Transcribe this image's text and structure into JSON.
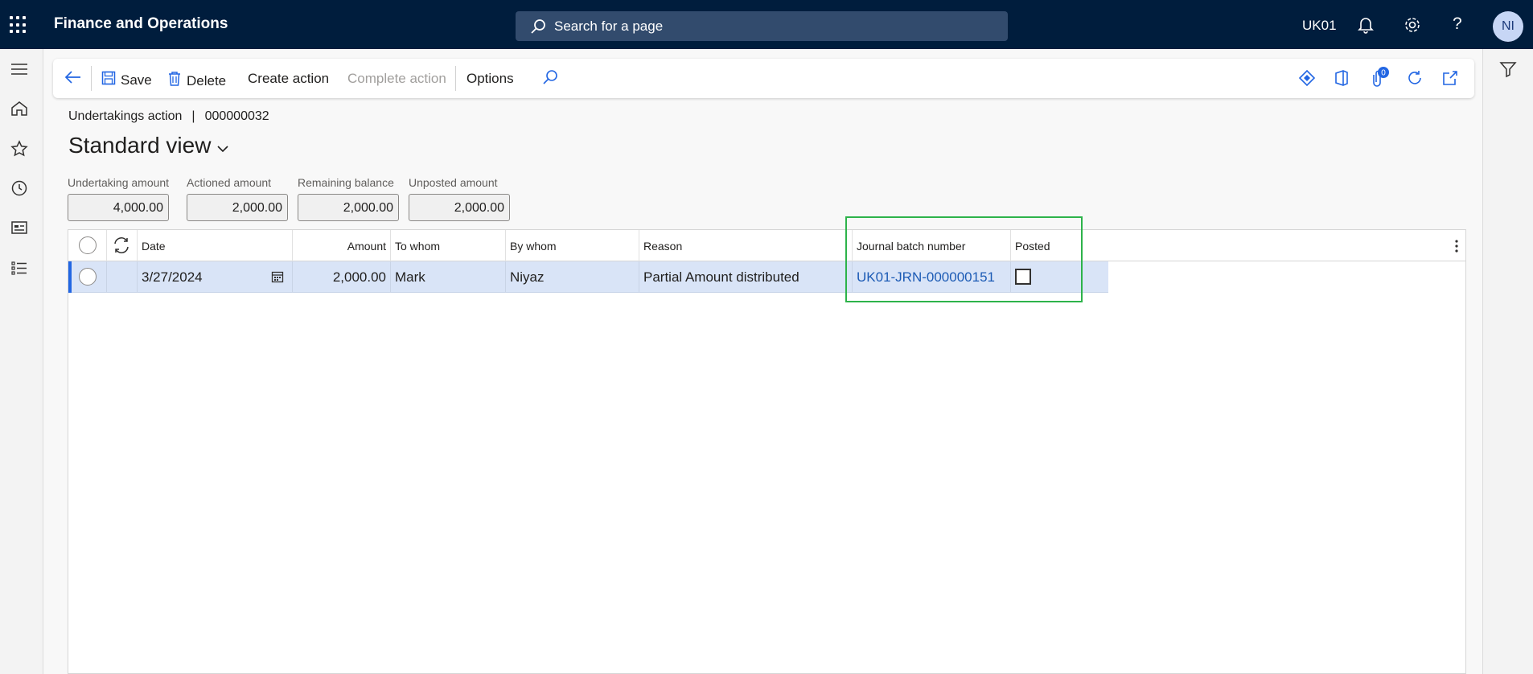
{
  "topbar": {
    "app_title": "Finance and Operations",
    "search_placeholder": "Search for a page",
    "company": "UK01",
    "avatar_initials": "NI",
    "icons": [
      "waffle-icon",
      "search-icon",
      "bell-icon",
      "gear-icon",
      "help-icon"
    ]
  },
  "leftnav": {
    "icons": [
      "hamburger-icon",
      "home-icon",
      "star-icon",
      "clock-icon",
      "workspace-icon",
      "list-icon"
    ]
  },
  "actionpane": {
    "save_label": "Save",
    "delete_label": "Delete",
    "create_action_label": "Create action",
    "complete_action_label": "Complete action",
    "options_label": "Options",
    "attachments_count": "0",
    "icons": [
      "back-arrow-icon",
      "save-icon",
      "delete-icon",
      "find-icon",
      "diamond-icon",
      "office-icon",
      "attachment-icon",
      "refresh-icon",
      "open-new-icon"
    ]
  },
  "header": {
    "entity": "Undertakings action",
    "separator": "|",
    "record_id": "000000032",
    "view_name": "Standard view"
  },
  "summary": [
    {
      "label": "Undertaking amount",
      "value": "4,000.00"
    },
    {
      "label": "Actioned amount",
      "value": "2,000.00"
    },
    {
      "label": "Remaining balance",
      "value": "2,000.00"
    },
    {
      "label": "Unposted amount",
      "value": "2,000.00"
    }
  ],
  "grid": {
    "columns": [
      "Date",
      "Amount",
      "To whom",
      "By whom",
      "Reason",
      "Journal batch number",
      "Posted"
    ],
    "rows": [
      {
        "date": "3/27/2024",
        "amount": "2,000.00",
        "to_whom": "Mark",
        "by_whom": "Niyaz",
        "reason": "Partial Amount distributed",
        "journal_batch_number": "UK01-JRN-000000151",
        "posted": false
      }
    ]
  },
  "colors": {
    "topbar_bg": "#001d3d",
    "search_bg": "#324b6d",
    "selected_row": "#d9e4f7",
    "accent": "#2266e3",
    "link": "#1c5bb5",
    "highlight_box": "#2db34a"
  }
}
